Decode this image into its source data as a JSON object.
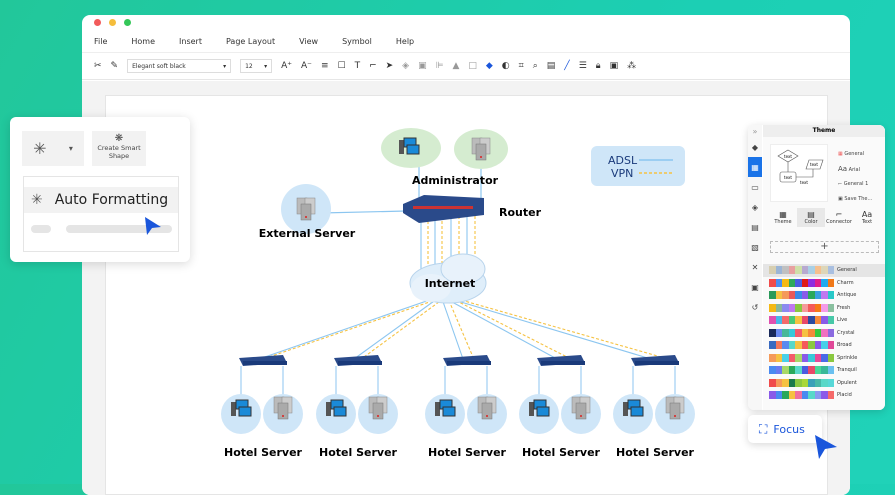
{
  "window": {
    "dots": [
      "#f25b5b",
      "#f5bd3c",
      "#35c759"
    ]
  },
  "menu": [
    "File",
    "Home",
    "Insert",
    "Page Layout",
    "View",
    "Symbol",
    "Help"
  ],
  "toolbar": {
    "font": "Elegant soft black",
    "size": "12"
  },
  "float_panel": {
    "create_smart_shape": "Create Smart Shape",
    "auto_formatting": "Auto Formatting"
  },
  "diagram": {
    "administrator": "Administrator",
    "router": "Router",
    "external_server": "External Server",
    "internet": "Internet",
    "hotel_servers": [
      "Hotel Server",
      "Hotel Server",
      "Hotel Server",
      "Hotel Server",
      "Hotel Server"
    ],
    "legend": [
      {
        "label": "ADSL",
        "color": "#8cc6f0",
        "style": "solid"
      },
      {
        "label": "VPN",
        "color": "#f5c242",
        "style": "dashed"
      }
    ]
  },
  "theme_panel": {
    "title": "Theme",
    "options": [
      "General",
      "Arial",
      "General 1",
      "Save The..."
    ],
    "tabs": [
      "Theme",
      "Color",
      "Connector",
      "Text"
    ],
    "active_tab": "Color",
    "add": "+",
    "preview_texts": [
      "text",
      "text",
      "text",
      "text"
    ],
    "palettes": [
      {
        "name": "General",
        "colors": [
          "#d7cfb1",
          "#9bb5d6",
          "#c0c0c0",
          "#e8a0a0",
          "#cfe0a8",
          "#b7a9d0",
          "#a9d0e6",
          "#f6bf8d",
          "#ddd6b8",
          "#a9bfe0"
        ]
      },
      {
        "name": "Charm",
        "colors": [
          "#f04b4b",
          "#4a8ef0",
          "#f5b914",
          "#2ea85a",
          "#4a5be0",
          "#e01818",
          "#8e2ee0",
          "#e0208a",
          "#1eaaf0",
          "#f07818"
        ]
      },
      {
        "name": "Antique",
        "colors": [
          "#2a9a5a",
          "#f5c242",
          "#f59a5a",
          "#e85a5a",
          "#3a8ae8",
          "#8a5ae8",
          "#2aa85a",
          "#3aa0e0",
          "#c078f0",
          "#28c8c8"
        ]
      },
      {
        "name": "Fresh",
        "colors": [
          "#f5b914",
          "#8ab89a",
          "#8a8af0",
          "#c078f0",
          "#8ac840",
          "#f59a9a",
          "#f55a5a",
          "#f57a18",
          "#f59ae8",
          "#8ac0a0"
        ]
      },
      {
        "name": "Live",
        "colors": [
          "#e050b0",
          "#48b8e8",
          "#f56a6a",
          "#48c878",
          "#f5c242",
          "#e84868",
          "#2a4aa0",
          "#f58a3a",
          "#8a5ae8",
          "#48c8a8"
        ]
      },
      {
        "name": "Crystal",
        "colors": [
          "#1a2a5a",
          "#6a8af0",
          "#48b898",
          "#38c8d8",
          "#f55a6a",
          "#f5c242",
          "#f58a3a",
          "#38c840",
          "#f070c0",
          "#8a6ae0"
        ]
      },
      {
        "name": "Broad",
        "colors": [
          "#3a6ac0",
          "#f5785a",
          "#5a8af0",
          "#58d8c8",
          "#f5c242",
          "#f55a5a",
          "#8ac840",
          "#8a5ae8",
          "#48d0e8",
          "#e04898"
        ]
      },
      {
        "name": "Sprinkle",
        "colors": [
          "#f59a5a",
          "#f5c242",
          "#48d0e8",
          "#f55a6a",
          "#a8d868",
          "#8a5ae8",
          "#38c8d8",
          "#e84898",
          "#4a6ae8",
          "#8ac840"
        ]
      },
      {
        "name": "Tranquil",
        "colors": [
          "#4a8af0",
          "#6a7af0",
          "#a8d868",
          "#2aa85a",
          "#58d8c8",
          "#4a5ae0",
          "#e84868",
          "#48d898",
          "#38b898",
          "#6ac0f0"
        ]
      },
      {
        "name": "Opulent",
        "colors": [
          "#f04b4b",
          "#f59a5a",
          "#f5c242",
          "#1a7a4a",
          "#8ac840",
          "#a8d838",
          "#3aa0b8",
          "#48b8a8",
          "#58d8c8",
          "#58d8d8"
        ]
      },
      {
        "name": "Placid",
        "colors": [
          "#8a5ae8",
          "#4a8af0",
          "#2aa85a",
          "#f5c242",
          "#f070a0",
          "#4a8af0",
          "#58d8c8",
          "#8a9af0",
          "#8a5ae8",
          "#f56a6a"
        ]
      }
    ]
  },
  "focus": {
    "label": "Focus"
  }
}
